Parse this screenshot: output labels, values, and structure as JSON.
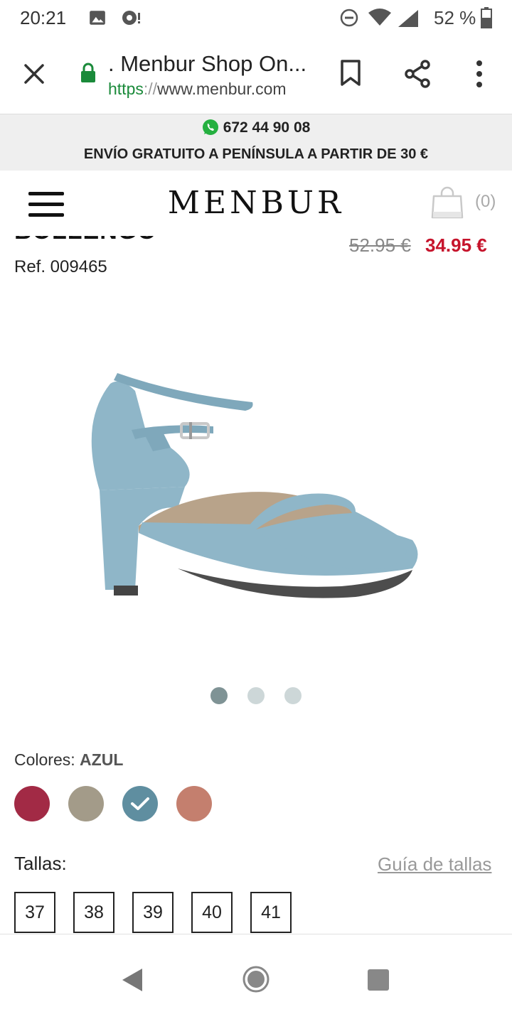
{
  "status_bar": {
    "time": "20:21",
    "battery": "52 %",
    "icons": [
      "image-icon",
      "podcast-icon",
      "dnd-icon",
      "wifi-icon",
      "signal-icon",
      "battery-icon"
    ]
  },
  "browser": {
    "title": ". Menbur Shop On...",
    "url_scheme": "https",
    "url_sep": "://",
    "url_host": "www.menbur.com",
    "icons": [
      "close-icon",
      "lock-icon",
      "bookmark-icon",
      "share-icon",
      "more-vert-icon"
    ]
  },
  "promo": {
    "phone": "672 44 90 08",
    "shipping": "ENVÍO GRATUITO A PENÍNSULA A PARTIR DE 30 €"
  },
  "header": {
    "logo": "MENBUR",
    "cart_count": "(0)"
  },
  "product": {
    "name": "BOLLENGO",
    "ref": "Ref. 009465",
    "old_price": "52.95 €",
    "new_price": "34.95 €",
    "gallery_active": 0,
    "gallery_count": 3,
    "colors_label": "Colores:",
    "colors_selected": "AZUL",
    "colors": [
      {
        "hex": "#a22a45",
        "selected": false
      },
      {
        "hex": "#a39b89",
        "selected": false
      },
      {
        "hex": "#5f8ea0",
        "selected": true
      },
      {
        "hex": "#c47f6e",
        "selected": false
      }
    ],
    "sizes_label": "Tallas:",
    "size_guide": "Guía de tallas",
    "sizes": [
      "37",
      "38",
      "39",
      "40",
      "41"
    ]
  },
  "colors": {
    "accent_green": "#1a8a3a",
    "price_red": "#c6142c",
    "shoe_blue": "#8fb6c8"
  }
}
